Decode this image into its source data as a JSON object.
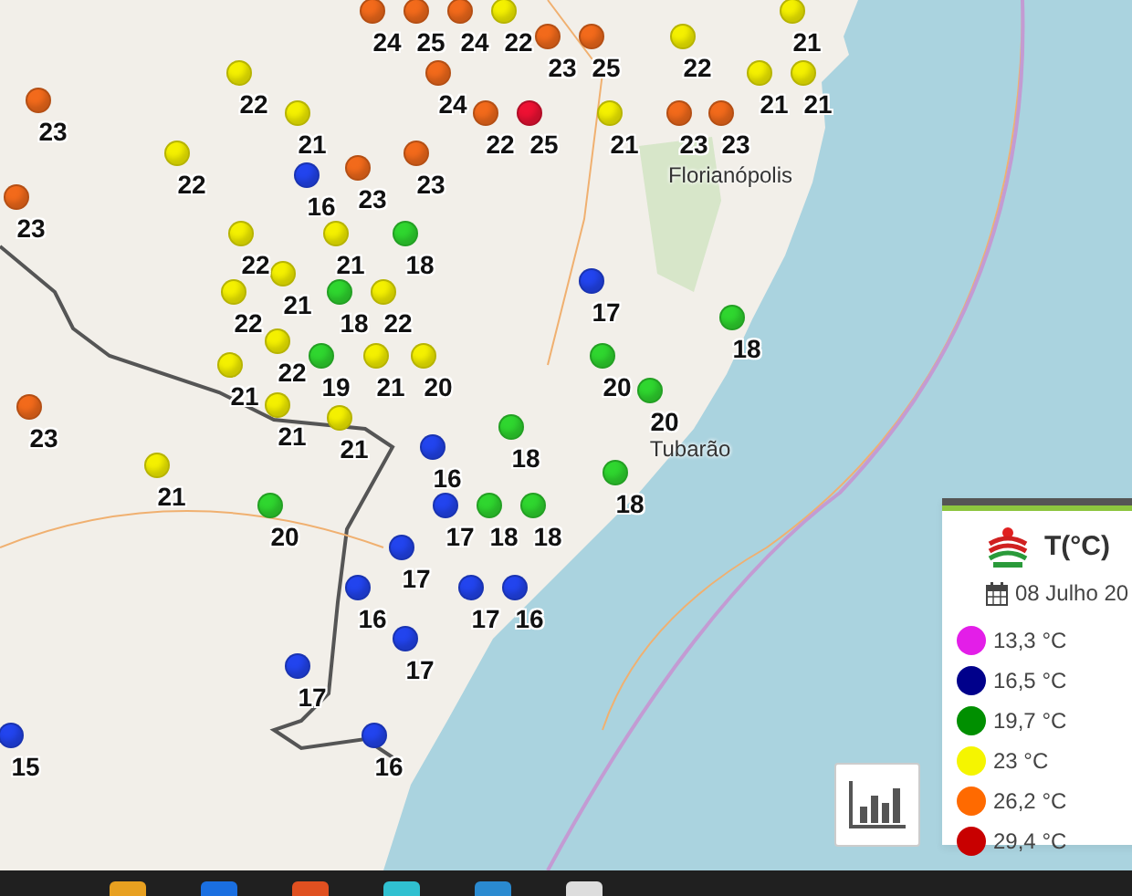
{
  "map": {
    "places": [
      {
        "label": "Florianópolis"
      },
      {
        "label": "Tubarão"
      }
    ],
    "markers": [
      {
        "value": "24",
        "color": "#f26a1b"
      },
      {
        "value": "25",
        "color": "#f26a1b"
      },
      {
        "value": "24",
        "color": "#f26a1b"
      },
      {
        "value": "22",
        "color": "#f4f000"
      },
      {
        "value": "21",
        "color": "#f4f000"
      },
      {
        "value": "23",
        "color": "#f26a1b"
      },
      {
        "value": "25",
        "color": "#f26a1b"
      },
      {
        "value": "22",
        "color": "#f4f000"
      },
      {
        "value": "22",
        "color": "#f4f000"
      },
      {
        "value": "24",
        "color": "#f26a1b"
      },
      {
        "value": "21",
        "color": "#f4f000"
      },
      {
        "value": "21",
        "color": "#f4f000"
      },
      {
        "value": "23",
        "color": "#f26a1b"
      },
      {
        "value": "21",
        "color": "#f4f000"
      },
      {
        "value": "22",
        "color": "#f26a1b"
      },
      {
        "value": "25",
        "color": "#ee1133"
      },
      {
        "value": "21",
        "color": "#f4f000"
      },
      {
        "value": "23",
        "color": "#f26a1b"
      },
      {
        "value": "23",
        "color": "#f26a1b"
      },
      {
        "value": "22",
        "color": "#f4f000"
      },
      {
        "value": "23",
        "color": "#f26a1b"
      },
      {
        "value": "23",
        "color": "#f26a1b"
      },
      {
        "value": "16",
        "color": "#2244ee"
      },
      {
        "value": "23",
        "color": "#f26a1b"
      },
      {
        "value": "22",
        "color": "#f4f000"
      },
      {
        "value": "21",
        "color": "#f4f000"
      },
      {
        "value": "18",
        "color": "#2fd62f"
      },
      {
        "value": "21",
        "color": "#f4f000"
      },
      {
        "value": "17",
        "color": "#2244ee"
      },
      {
        "value": "22",
        "color": "#f4f000"
      },
      {
        "value": "18",
        "color": "#2fd62f"
      },
      {
        "value": "22",
        "color": "#f4f000"
      },
      {
        "value": "18",
        "color": "#2fd62f"
      },
      {
        "value": "22",
        "color": "#f4f000"
      },
      {
        "value": "19",
        "color": "#2fd62f"
      },
      {
        "value": "21",
        "color": "#f4f000"
      },
      {
        "value": "20",
        "color": "#f4f000"
      },
      {
        "value": "20",
        "color": "#2fd62f"
      },
      {
        "value": "21",
        "color": "#f4f000"
      },
      {
        "value": "20",
        "color": "#2fd62f"
      },
      {
        "value": "21",
        "color": "#f4f000"
      },
      {
        "value": "23",
        "color": "#f26a1b"
      },
      {
        "value": "21",
        "color": "#f4f000"
      },
      {
        "value": "18",
        "color": "#2fd62f"
      },
      {
        "value": "16",
        "color": "#2244ee"
      },
      {
        "value": "21",
        "color": "#f4f000"
      },
      {
        "value": "18",
        "color": "#2fd62f"
      },
      {
        "value": "20",
        "color": "#2fd62f"
      },
      {
        "value": "17",
        "color": "#2244ee"
      },
      {
        "value": "18",
        "color": "#2fd62f"
      },
      {
        "value": "18",
        "color": "#2fd62f"
      },
      {
        "value": "17",
        "color": "#2244ee"
      },
      {
        "value": "16",
        "color": "#2244ee"
      },
      {
        "value": "17",
        "color": "#2244ee"
      },
      {
        "value": "16",
        "color": "#2244ee"
      },
      {
        "value": "17",
        "color": "#2244ee"
      },
      {
        "value": "17",
        "color": "#2244ee"
      },
      {
        "value": "15",
        "color": "#2244ee"
      },
      {
        "value": "16",
        "color": "#2244ee"
      }
    ]
  },
  "legend": {
    "title": "T(°C)",
    "date": "08 Julho 20",
    "items": [
      {
        "label": "13,3 °C",
        "color": "#e31ee8"
      },
      {
        "label": "16,5 °C",
        "color": "#00008b"
      },
      {
        "label": "19,7 °C",
        "color": "#008f00"
      },
      {
        "label": "23 °C",
        "color": "#f5f500"
      },
      {
        "label": "26,2 °C",
        "color": "#ff6a00"
      },
      {
        "label": "29,4 °C",
        "color": "#c80000"
      }
    ]
  }
}
